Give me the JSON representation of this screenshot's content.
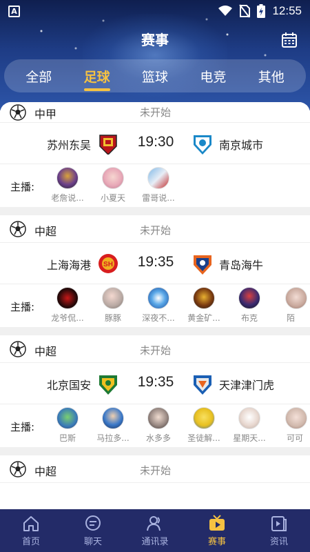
{
  "status_bar": {
    "time": "12:55",
    "app_icon": "A"
  },
  "header": {
    "title": "赛事"
  },
  "tabs": [
    {
      "label": "全部",
      "active": false
    },
    {
      "label": "足球",
      "active": true
    },
    {
      "label": "篮球",
      "active": false
    },
    {
      "label": "电竞",
      "active": false
    },
    {
      "label": "其他",
      "active": false
    }
  ],
  "hosts_label": "主播:",
  "matches": [
    {
      "league": "中甲",
      "status": "未开始",
      "home": "苏州东吴",
      "time": "19:30",
      "away": "南京城市",
      "hosts": [
        "老詹说...",
        "小夏天",
        "雷哥说..."
      ]
    },
    {
      "league": "中超",
      "status": "未开始",
      "home": "上海海港",
      "time": "19:35",
      "away": "青岛海牛",
      "hosts": [
        "龙爷侃...",
        "豚豚",
        "深夜不...",
        "黄金矿...",
        "布克",
        "陌"
      ]
    },
    {
      "league": "中超",
      "status": "未开始",
      "home": "北京国安",
      "time": "19:35",
      "away": "天津津门虎",
      "hosts": [
        "巴斯",
        "马拉多...",
        "水多多",
        "圣徒解...",
        "星期天...",
        "可可"
      ]
    },
    {
      "league": "中超",
      "status": "未开始"
    }
  ],
  "bottom_nav": [
    {
      "label": "首页",
      "icon": "home-icon",
      "active": false
    },
    {
      "label": "聊天",
      "icon": "chat-icon",
      "active": false
    },
    {
      "label": "通讯录",
      "icon": "contacts-icon",
      "active": false
    },
    {
      "label": "赛事",
      "icon": "tv-icon",
      "active": true
    },
    {
      "label": "资讯",
      "icon": "news-icon",
      "active": false
    }
  ],
  "colors": {
    "accent": "#f5c242",
    "nav_bg": "#232b68",
    "header_top": "#0f1f4f"
  }
}
